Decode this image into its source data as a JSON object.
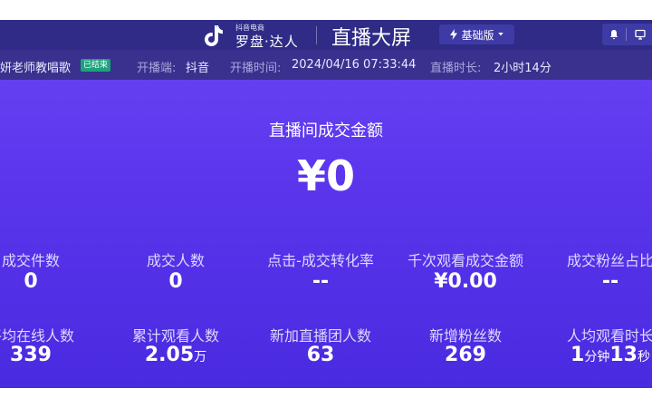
{
  "header": {
    "brand_small": "抖音电商",
    "brand_main": "罗盘·达人",
    "title": "直播大屏",
    "version_label": "基础版"
  },
  "info": {
    "room_name": "妍老师教唱歌",
    "status_badge": "已结束",
    "platform_label": "开播端:",
    "platform_value": "抖音",
    "start_label": "开播时间:",
    "start_value": "2024/04/16 07:33:44",
    "duration_label": "直播时长:",
    "duration_value": "2小时14分"
  },
  "gmv": {
    "label": "直播间成交金额",
    "value": "¥0"
  },
  "metrics_row1": [
    {
      "label": "成交件数",
      "value": "0"
    },
    {
      "label": "成交人数",
      "value": "0"
    },
    {
      "label": "点击-成交转化率",
      "value": "--"
    },
    {
      "label": "千次观看成交金额",
      "value": "¥0.00"
    },
    {
      "label": "成交粉丝占比",
      "value": "--"
    }
  ],
  "metrics_row2": [
    {
      "label": "平均在线人数",
      "value": "339"
    },
    {
      "label": "累计观看人数",
      "value": "2.05",
      "unit": "万"
    },
    {
      "label": "新加直播团人数",
      "value": "63"
    },
    {
      "label": "新增粉丝数",
      "value": "269"
    },
    {
      "label": "人均观看时长",
      "value_a": "1",
      "unit_a": "分钟",
      "value_b": "13",
      "unit_b": "秒"
    }
  ],
  "colors": {
    "topbar": "#2f2b86",
    "infobar": "#3a318f",
    "badge": "#1aa37a",
    "background": "#5a35ec"
  },
  "icons": [
    "tiktok-logo-icon",
    "lightning-icon",
    "caret-down-icon",
    "bell-icon",
    "monitor-icon"
  ]
}
